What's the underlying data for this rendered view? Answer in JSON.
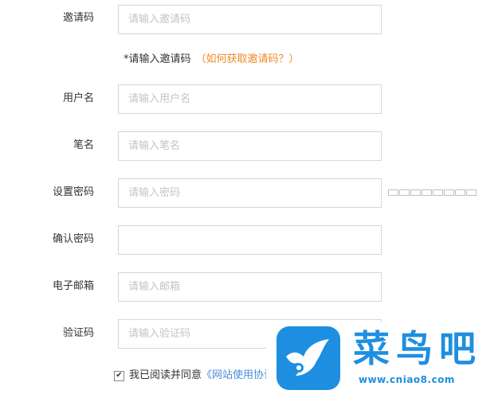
{
  "form": {
    "invite": {
      "label": "邀请码",
      "placeholder": "请输入邀请码"
    },
    "invite_hint": {
      "text": "*请输入邀请码",
      "link": "（如何获取邀请码？）"
    },
    "username": {
      "label": "用户名",
      "placeholder": "请输入用户名"
    },
    "penname": {
      "label": "笔名",
      "placeholder": "请输入笔名"
    },
    "password": {
      "label": "设置密码",
      "placeholder": "请输入密码"
    },
    "confirm": {
      "label": "确认密码",
      "placeholder": ""
    },
    "email": {
      "label": "电子邮箱",
      "placeholder": "请输入邮箱"
    },
    "captcha": {
      "label": "验证码",
      "placeholder": "请输入验证码"
    },
    "agree": {
      "prefix": "我已阅读并同意",
      "terms": "《网站使用协议》",
      "checked": true
    }
  },
  "watermark": {
    "brand": "菜鸟吧",
    "url": "www.cniao8.com",
    "color": "#1e8fe0"
  },
  "colors": {
    "link_orange": "#f08a24",
    "link_blue": "#4a8bd6",
    "border": "#d6d6d6"
  }
}
